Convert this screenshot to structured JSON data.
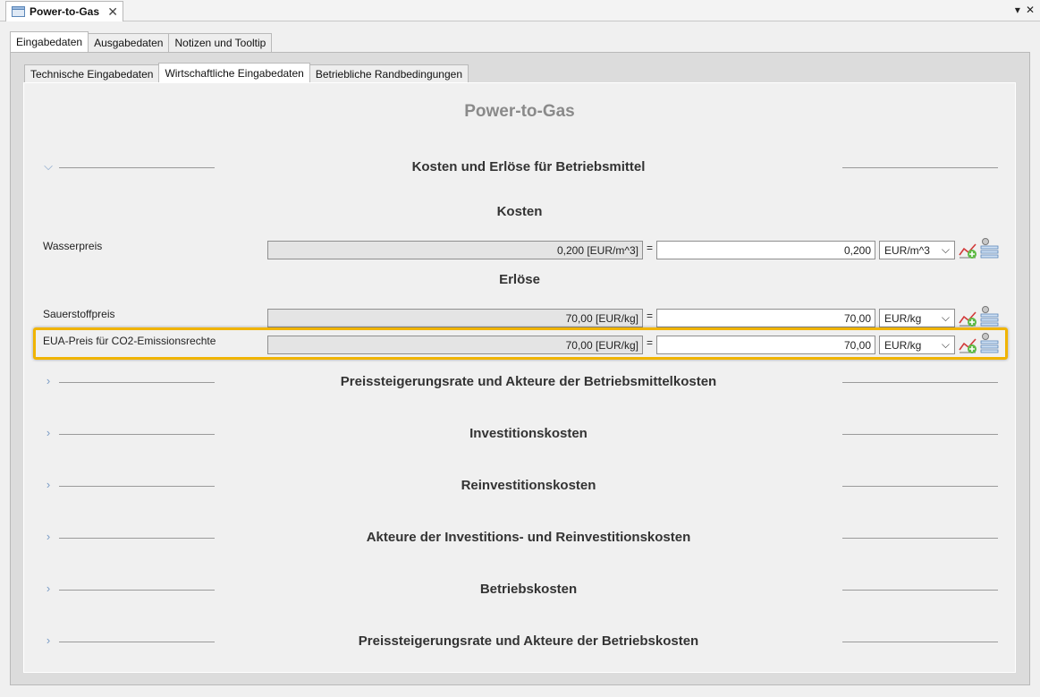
{
  "document_tab": {
    "title": "Power-to-Gas",
    "close": "✕"
  },
  "window_controls": {
    "menu": "▾",
    "close": "✕"
  },
  "outer_tabs": [
    "Eingabedaten",
    "Ausgabedaten",
    "Notizen und Tooltip"
  ],
  "inner_tabs": [
    "Technische Eingabedaten",
    "Wirtschaftliche Eingabedaten",
    "Betriebliche Randbedingungen"
  ],
  "page_title": "Power-to-Gas",
  "sections": [
    {
      "title": "Kosten und Erlöse für Betriebsmittel",
      "expanded": true,
      "chevron": "⌵"
    },
    {
      "title": "Preissteigerungsrate und Akteure der Betriebsmittelkosten",
      "expanded": false,
      "chevron": "›"
    },
    {
      "title": "Investitionskosten",
      "expanded": false,
      "chevron": "›"
    },
    {
      "title": "Reinvestitionskosten",
      "expanded": false,
      "chevron": "›"
    },
    {
      "title": "Akteure der Investitions- und Reinvestitionskosten",
      "expanded": false,
      "chevron": "›"
    },
    {
      "title": "Betriebskosten",
      "expanded": false,
      "chevron": "›"
    },
    {
      "title": "Preissteigerungsrate und Akteure der Betriebskosten",
      "expanded": false,
      "chevron": "›"
    }
  ],
  "subheads": {
    "costs": "Kosten",
    "revenues": "Erlöse"
  },
  "rows": [
    {
      "label": "Wasserpreis",
      "computed": "0,200 [EUR/m^3]",
      "equals": "=",
      "value": "0,200",
      "unit": "EUR/m^3"
    },
    {
      "label": "Sauerstoffpreis",
      "computed": "70,00 [EUR/kg]",
      "equals": "=",
      "value": "70,00",
      "unit": "EUR/kg"
    },
    {
      "label": "EUA-Preis für CO2-Emissionsrechte",
      "computed": "70,00 [EUR/kg]",
      "equals": "=",
      "value": "70,00",
      "unit": "EUR/kg",
      "highlighted": true
    }
  ],
  "colors": {
    "highlight": "#f0b400",
    "chevron": "#7a9cc6",
    "title": "#8a8a8a"
  }
}
